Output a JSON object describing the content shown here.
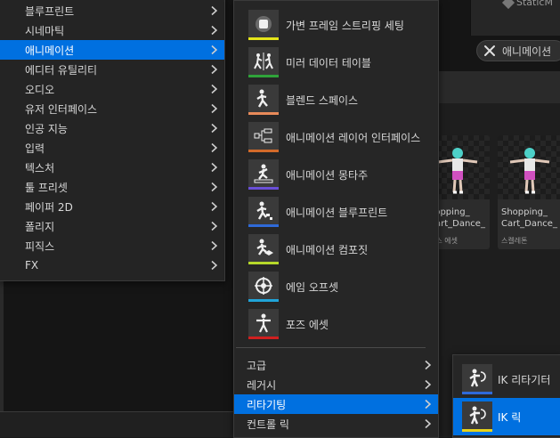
{
  "background": {
    "top_right_label": "StaticM",
    "filter_chip_label": "애니메이션",
    "cards": [
      {
        "title": "Shopping_\nCart_Dance_",
        "type": "픽스 에셋",
        "visible_title": "hopping_\nCart_Dance_"
      },
      {
        "title": "Shopping_\nCart_Dance_",
        "type": "스켈레톤"
      }
    ]
  },
  "menu1": {
    "items": [
      {
        "label": "블루프린트"
      },
      {
        "label": "시네마틱"
      },
      {
        "label": "애니메이션"
      },
      {
        "label": "에디터 유틸리티"
      },
      {
        "label": "오디오"
      },
      {
        "label": "유저 인터페이스"
      },
      {
        "label": "인공 지능"
      },
      {
        "label": "입력"
      },
      {
        "label": "텍스처"
      },
      {
        "label": "툴 프리셋"
      },
      {
        "label": "페이퍼 2D"
      },
      {
        "label": "폴리지"
      },
      {
        "label": "피직스"
      },
      {
        "label": "FX"
      }
    ],
    "selected_index": 2
  },
  "menu2": {
    "assets": [
      {
        "label": "가변 프레임 스트리핑 세팅",
        "icon": "frame-stripping-icon",
        "color": "#e6e61a"
      },
      {
        "label": "미러 데이터 테이블",
        "icon": "mirror-table-icon",
        "color": "#2fa33a"
      },
      {
        "label": "블렌드 스페이스",
        "icon": "blend-space-icon",
        "color": "#e88a5a"
      },
      {
        "label": "애니메이션 레이어 인터페이스",
        "icon": "layer-interface-icon",
        "color": "#d36a2a"
      },
      {
        "label": "애니메이션 몽타주",
        "icon": "montage-icon",
        "color": "#6a4fd8"
      },
      {
        "label": "애니메이션 블루프린트",
        "icon": "anim-blueprint-icon",
        "color": "#2f6ad8"
      },
      {
        "label": "애니메이션 컴포짓",
        "icon": "composite-icon",
        "color": "#b6d82a"
      },
      {
        "label": "에임 오프셋",
        "icon": "aim-offset-icon",
        "color": "#20a4d8"
      },
      {
        "label": "포즈 에셋",
        "icon": "pose-asset-icon",
        "color": "#d02020"
      }
    ],
    "submenus": [
      {
        "label": "고급"
      },
      {
        "label": "레거시"
      },
      {
        "label": "리타기팅"
      },
      {
        "label": "컨트롤 릭"
      }
    ],
    "selected_submenu_index": 2
  },
  "menu3": {
    "items": [
      {
        "label": "IK 리타기터",
        "icon": "ik-retargeter-icon",
        "color": "#2f6ad8"
      },
      {
        "label": "IK 릭",
        "icon": "ik-rig-icon",
        "color": "#e6d21a"
      }
    ],
    "selected_index": 1
  },
  "colors": {
    "accent": "#0070e0",
    "menu_bg": "#242424",
    "hover_bg": "#303030"
  }
}
